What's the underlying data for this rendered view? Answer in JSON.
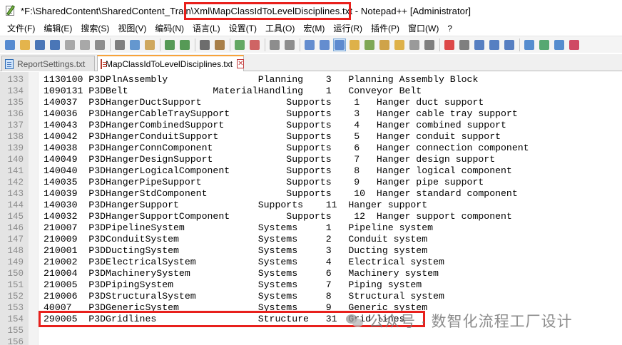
{
  "window": {
    "title": "*F:\\SharedContent\\SharedContent_Train\\Xml\\MapClassIdToLevelDisciplines.txt - Notepad++ [Administrator]"
  },
  "menu": [
    "文件(F)",
    "编辑(E)",
    "搜索(S)",
    "视图(V)",
    "编码(N)",
    "语言(L)",
    "设置(T)",
    "工具(O)",
    "宏(M)",
    "运行(R)",
    "插件(P)",
    "窗口(W)",
    "?"
  ],
  "toolbar_icons": [
    {
      "name": "new-file-icon",
      "color": "#3b78c9"
    },
    {
      "name": "open-file-icon",
      "color": "#e0a82e"
    },
    {
      "name": "save-icon",
      "color": "#2b5fab"
    },
    {
      "name": "save-all-icon",
      "color": "#2b5fab"
    },
    {
      "name": "close-icon",
      "color": "#9a9a9a"
    },
    {
      "name": "close-all-icon",
      "color": "#9a9a9a"
    },
    {
      "name": "print-icon",
      "color": "#7a7a7a"
    },
    {
      "sep": true
    },
    {
      "name": "cut-icon",
      "color": "#6a6a6a"
    },
    {
      "name": "copy-icon",
      "color": "#4a86c8"
    },
    {
      "name": "paste-icon",
      "color": "#c89a42"
    },
    {
      "sep": true
    },
    {
      "name": "undo-icon",
      "color": "#3a8a3a"
    },
    {
      "name": "redo-icon",
      "color": "#3a8a3a"
    },
    {
      "sep": true
    },
    {
      "name": "find-icon",
      "color": "#555555"
    },
    {
      "name": "replace-icon",
      "color": "#9a6a2a"
    },
    {
      "sep": true
    },
    {
      "name": "zoom-in-icon",
      "color": "#4a9a4a"
    },
    {
      "name": "zoom-out-icon",
      "color": "#c84a4a"
    },
    {
      "sep": true
    },
    {
      "name": "sync-vertical-icon",
      "color": "#7a7a7a"
    },
    {
      "name": "sync-horizontal-icon",
      "color": "#7a7a7a"
    },
    {
      "sep": true
    },
    {
      "name": "word-wrap-icon",
      "color": "#4a7ac8"
    },
    {
      "name": "show-all-chars-icon",
      "color": "#4a7ac8"
    },
    {
      "name": "indent-guide-icon",
      "color": "#4a7ac8",
      "active": true
    },
    {
      "name": "user-language-icon",
      "color": "#d9a42a"
    },
    {
      "name": "document-map-icon",
      "color": "#6a9a3a"
    },
    {
      "name": "function-list-icon",
      "color": "#c8942a"
    },
    {
      "name": "folder-as-workspace-icon",
      "color": "#d9a42a"
    },
    {
      "name": "monitoring-icon",
      "color": "#8a8a8a"
    },
    {
      "name": "eye-icon",
      "color": "#6a6a6a"
    },
    {
      "sep": true
    },
    {
      "name": "record-macro-icon",
      "color": "#d82a2a"
    },
    {
      "name": "stop-recording-icon",
      "color": "#6a6a6a"
    },
    {
      "name": "playback-macro-icon",
      "color": "#3a6ab8"
    },
    {
      "name": "run-macro-multiple-icon",
      "color": "#3a6ab8"
    },
    {
      "name": "save-macro-icon",
      "color": "#3a6ab8"
    },
    {
      "sep": true
    },
    {
      "name": "plugin-a-icon",
      "color": "#3a7ac8"
    },
    {
      "name": "plugin-b-icon",
      "color": "#3a9a5a"
    },
    {
      "name": "plugin-c-icon",
      "color": "#3a7ac8"
    },
    {
      "name": "plugin-d-icon",
      "color": "#c82a4a"
    }
  ],
  "tabs": [
    {
      "label": "ReportSettings.txt",
      "active": false
    },
    {
      "label": "MapClassIdToLevelDisciplines.txt",
      "active": true
    }
  ],
  "lines": [
    {
      "n": "133",
      "text": "1130100 P3DPlnAssembly                Planning    3   Planning Assembly Block"
    },
    {
      "n": "134",
      "text": "1090131 P3DBelt               MaterialHandling    1   Conveyor Belt"
    },
    {
      "n": "135",
      "text": "140037  P3DHangerDuctSupport               Supports    1   Hanger duct support"
    },
    {
      "n": "136",
      "text": "140036  P3DHangerCableTraySupport          Supports    3   Hanger cable tray support"
    },
    {
      "n": "137",
      "text": "140043  P3DHangerCombinedSupport           Supports    4   Hanger combined support"
    },
    {
      "n": "138",
      "text": "140042  P3DHangerConduitSupport            Supports    5   Hanger conduit support"
    },
    {
      "n": "139",
      "text": "140038  P3DHangerConnComponent             Supports    6   Hanger connection component"
    },
    {
      "n": "140",
      "text": "140049  P3DHangerDesignSupport             Supports    7   Hanger design support"
    },
    {
      "n": "141",
      "text": "140040  P3DHangerLogicalComponent          Supports    8   Hanger logical component"
    },
    {
      "n": "142",
      "text": "140035  P3DHangerPipeSupport               Supports    9   Hanger pipe support"
    },
    {
      "n": "143",
      "text": "140039  P3DHangerStdComponent              Supports    10  Hanger standard component"
    },
    {
      "n": "144",
      "text": "140030  P3DHangerSupport              Supports    11  Hanger support"
    },
    {
      "n": "145",
      "text": "140032  P3DHangerSupportComponent          Supports    12  Hanger support component"
    },
    {
      "n": "146",
      "text": "210007  P3DPipelineSystem             Systems     1   Pipeline system"
    },
    {
      "n": "147",
      "text": "210009  P3DConduitSystem              Systems     2   Conduit system"
    },
    {
      "n": "148",
      "text": "210001  P3DDuctingSystem              Systems     3   Ducting system"
    },
    {
      "n": "149",
      "text": "210002  P3DElectricalSystem           Systems     4   Electrical system"
    },
    {
      "n": "150",
      "text": "210004  P3DMachinerySystem            Systems     6   Machinery system"
    },
    {
      "n": "151",
      "text": "210005  P3DPipingSystem               Systems     7   Piping system"
    },
    {
      "n": "152",
      "text": "210006  P3DStructuralSystem           Systems     8   Structural system"
    },
    {
      "n": "153",
      "text": "40007   P3DGenericSystem              Systems     9   Generic system"
    },
    {
      "n": "154",
      "text": "290005  P3DGridlines                  Structure   31  Grid lines"
    },
    {
      "n": "155",
      "text": ""
    },
    {
      "n": "156",
      "text": ""
    }
  ],
  "watermark": {
    "text": "公众号 · 数智化流程工厂设计"
  }
}
